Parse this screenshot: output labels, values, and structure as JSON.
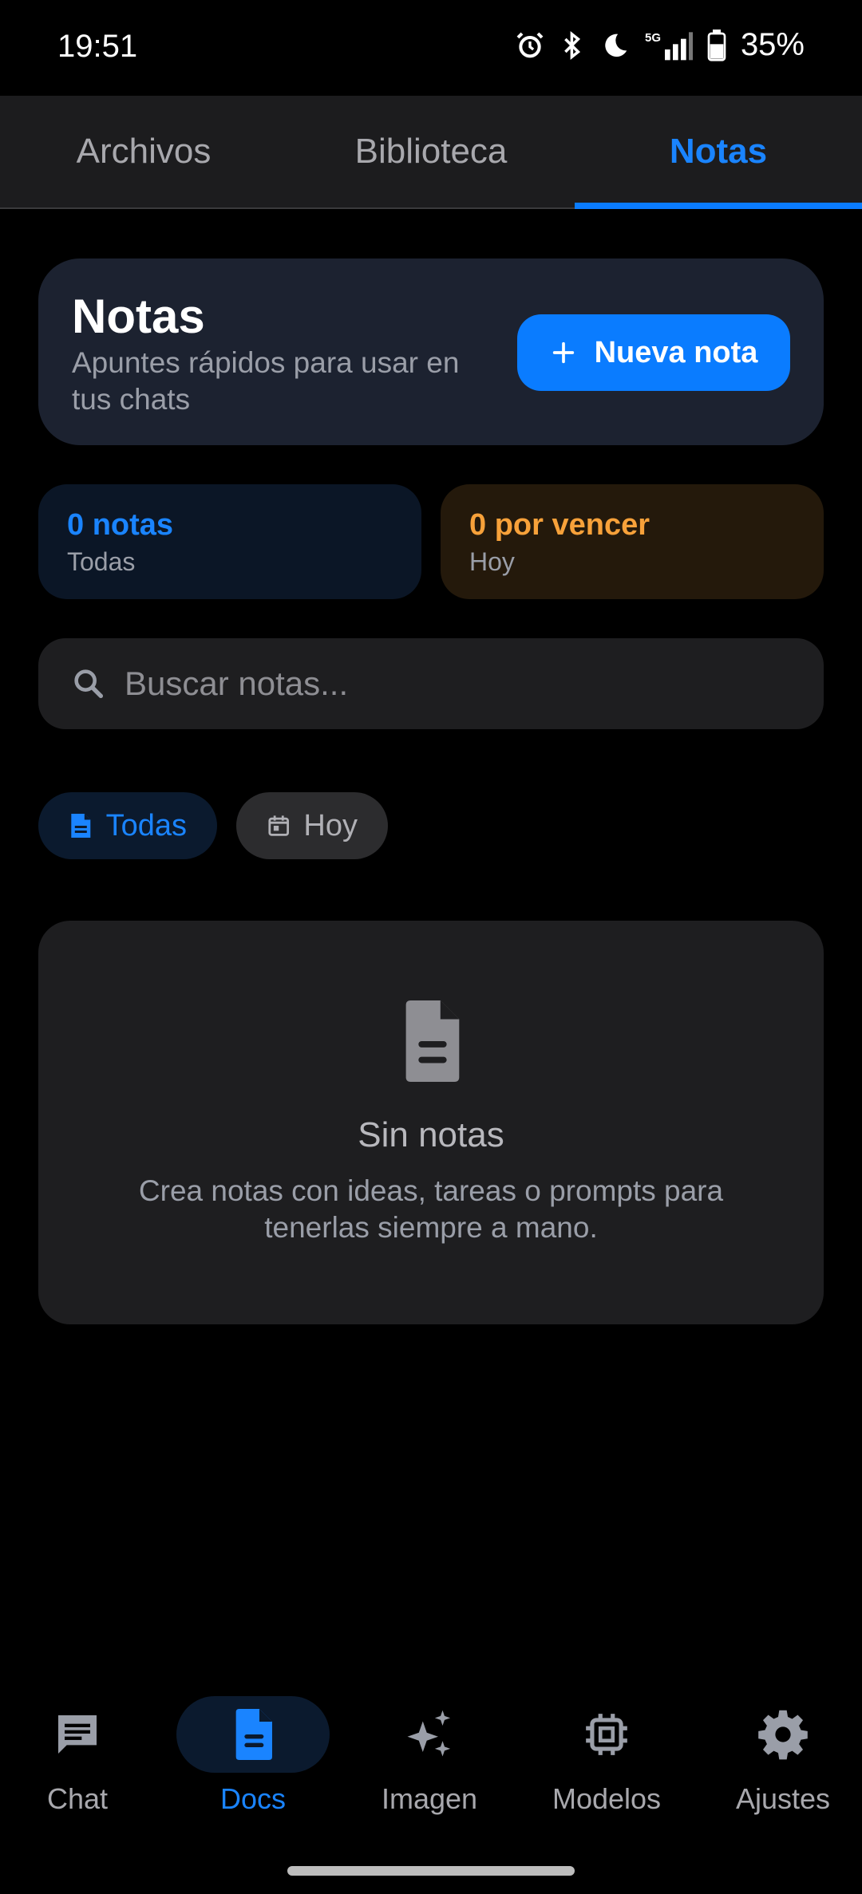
{
  "status_bar": {
    "time": "19:51",
    "network": "5G",
    "battery": "35%"
  },
  "top_tabs": [
    {
      "label": "Archivos",
      "active": false
    },
    {
      "label": "Biblioteca",
      "active": false
    },
    {
      "label": "Notas",
      "active": true
    }
  ],
  "header": {
    "title": "Notas",
    "subtitle": "Apuntes rápidos para usar en tus chats",
    "new_note_label": "Nueva nota"
  },
  "stats": {
    "notes": {
      "value": "0 notas",
      "label": "Todas"
    },
    "due": {
      "value": "0 por vencer",
      "label": "Hoy"
    }
  },
  "search": {
    "placeholder": "Buscar notas...",
    "value": ""
  },
  "filters": [
    {
      "label": "Todas",
      "icon": "document-icon",
      "selected": true
    },
    {
      "label": "Hoy",
      "icon": "calendar-icon",
      "selected": false
    }
  ],
  "empty_state": {
    "title": "Sin notas",
    "description": "Crea notas con ideas, tareas o prompts para tenerlas siempre a mano."
  },
  "bottom_nav": [
    {
      "label": "Chat",
      "icon": "chat-icon",
      "active": false
    },
    {
      "label": "Docs",
      "icon": "document-icon",
      "active": true
    },
    {
      "label": "Imagen",
      "icon": "sparkles-icon",
      "active": false
    },
    {
      "label": "Modelos",
      "icon": "chip-icon",
      "active": false
    },
    {
      "label": "Ajustes",
      "icon": "gear-icon",
      "active": false
    }
  ],
  "colors": {
    "accent": "#0a7cff",
    "warning": "#f7a13a",
    "background": "#000000",
    "card": "#1e1e20"
  }
}
